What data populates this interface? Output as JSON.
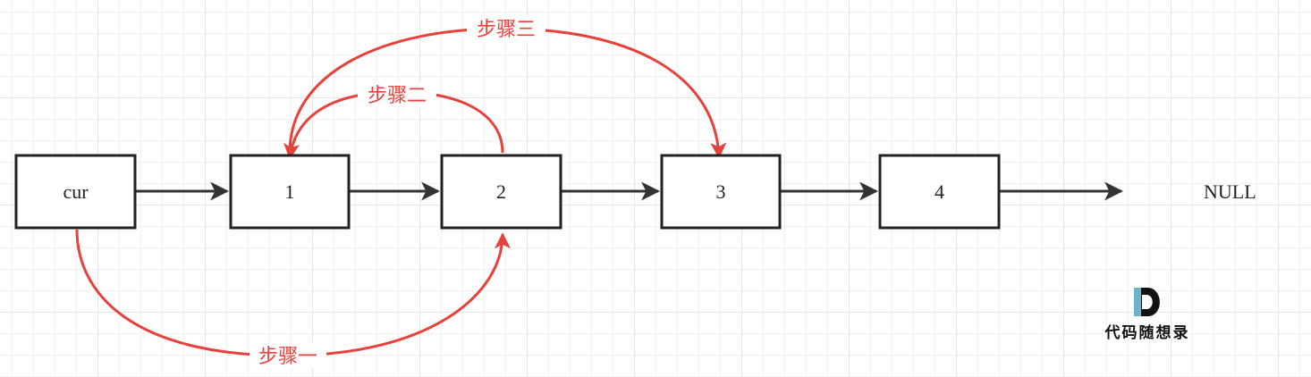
{
  "nodes": [
    {
      "id": "cur",
      "label": "cur"
    },
    {
      "id": "n1",
      "label": "1"
    },
    {
      "id": "n2",
      "label": "2"
    },
    {
      "id": "n3",
      "label": "3"
    },
    {
      "id": "n4",
      "label": "4"
    }
  ],
  "terminal": "NULL",
  "steps": {
    "step1": "步骤一",
    "step2": "步骤二",
    "step3": "步骤三"
  },
  "edges": [
    {
      "from": "cur",
      "to": "n1",
      "kind": "next-pointer"
    },
    {
      "from": "n1",
      "to": "n2",
      "kind": "next-pointer"
    },
    {
      "from": "n2",
      "to": "n3",
      "kind": "next-pointer"
    },
    {
      "from": "n3",
      "to": "n4",
      "kind": "next-pointer"
    },
    {
      "from": "n4",
      "to": "NULL",
      "kind": "next-pointer"
    },
    {
      "from": "cur",
      "to": "n2",
      "kind": "step",
      "label": "步骤一"
    },
    {
      "from": "n2",
      "to": "n1",
      "kind": "step",
      "label": "步骤二"
    },
    {
      "from": "n1",
      "to": "n3",
      "kind": "step",
      "label": "步骤三"
    }
  ],
  "logo": {
    "text": "代码随想录",
    "letter": "D"
  },
  "colors": {
    "node_border": "#222222",
    "pointer_arrow": "#333333",
    "step_arrow": "#e8403a",
    "step_text": "#e8403a",
    "grid_major": "#e6e6e6",
    "grid_minor": "#f1f1f1",
    "logo_accent": "#6fb3c8"
  }
}
